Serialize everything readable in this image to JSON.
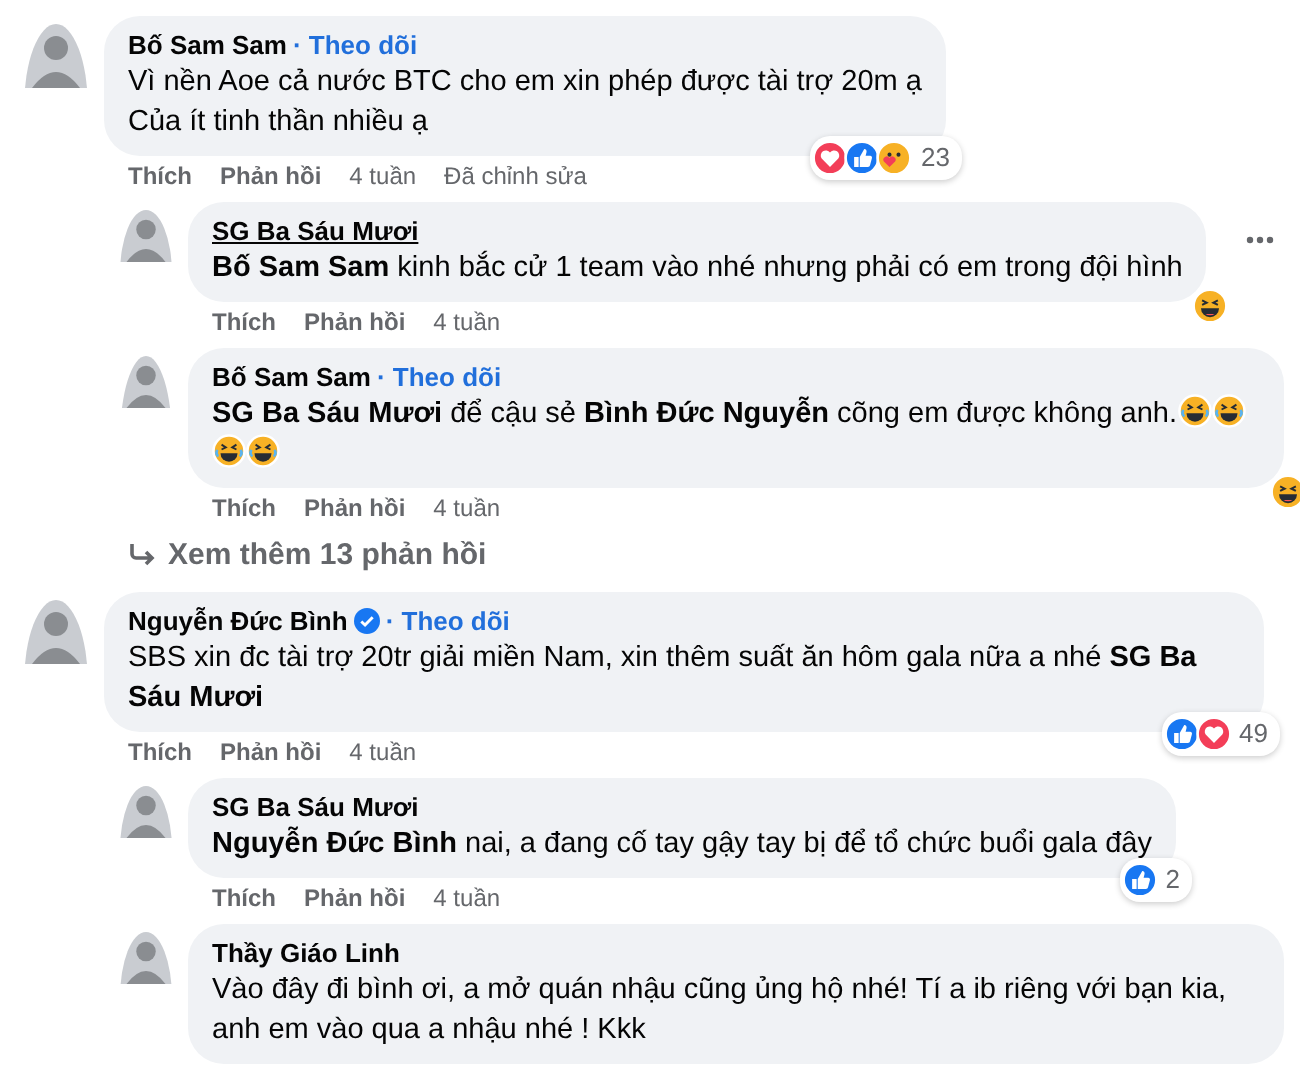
{
  "comments": [
    {
      "author": "Bố Sam Sam",
      "hovered": false,
      "verified": false,
      "follow": "· Theo dõi",
      "text": "Vì nền Aoe cả nước BTC cho em xin phép được tài trợ 20m ạ\nCủa ít tinh thần nhiều ạ",
      "actions": [
        "Thích",
        "Phản hồi",
        "4 tuần",
        "Đã chỉnh sửa"
      ],
      "reactions": {
        "kinds": [
          {
            "kind": "love"
          },
          {
            "kind": "like"
          },
          {
            "kind": "care"
          }
        ],
        "count": "23"
      },
      "more": false,
      "children": [
        {
          "author": "SG Ba Sáu Mươi",
          "hovered": true,
          "verified": false,
          "text": "**Bố Sam Sam** kinh bắc cử 1 team vào nhé nhưng phải có em trong đội hình",
          "actions": [
            "Thích",
            "Phản hồi",
            "4 tuần"
          ],
          "reactions": {
            "kinds": [
              {
                "kind": "haha"
              }
            ]
          },
          "more": true
        },
        {
          "author": "Bố Sam Sam",
          "hovered": false,
          "verified": false,
          "follow": "· Theo dõi",
          "text": "**SG Ba Sáu Mươi** để cậu sẻ **Bình Đức Nguyễn** cõng em được không anh.",
          "emoji": [
            {
              "kind": "rofl"
            },
            {
              "kind": "rofl"
            },
            {
              "kind": "rofl"
            },
            {
              "kind": "rofl"
            }
          ],
          "actions": [
            "Thích",
            "Phản hồi",
            "4 tuần"
          ],
          "reactions": {
            "kinds": [
              {
                "kind": "haha"
              }
            ]
          },
          "more": false
        }
      ],
      "more_replies": "Xem thêm 13 phản hồi"
    },
    {
      "author": "Nguyễn Đức Bình",
      "hovered": false,
      "verified": true,
      "follow": "· Theo dõi",
      "text": "SBS xin đc tài trợ 20tr giải miền Nam, xin thêm suất ăn hôm gala nữa a nhé **SG Ba Sáu Mươi**",
      "actions": [
        "Thích",
        "Phản hồi",
        "4 tuần"
      ],
      "reactions": {
        "kinds": [
          {
            "kind": "like"
          },
          {
            "kind": "love"
          }
        ],
        "count": "49"
      },
      "more": false,
      "children": [
        {
          "author": "SG Ba Sáu Mươi",
          "hovered": false,
          "verified": false,
          "text": "**Nguyễn Đức Bình** nai, a đang cố tay gậy tay bị để tổ chức buổi gala đây",
          "actions": [
            "Thích",
            "Phản hồi",
            "4 tuần"
          ],
          "reactions": {
            "kinds": [
              {
                "kind": "like"
              }
            ],
            "count": "2"
          },
          "more": false
        },
        {
          "author": "Thầy Giáo Linh",
          "hovered": false,
          "verified": false,
          "text": "Vào đây đi bình ơi, a mở quán nhậu cũng ủng hộ nhé! Tí a ib riêng với bạn kia, anh em vào qua a nhậu nhé ! Kkk",
          "more": false
        }
      ]
    }
  ]
}
